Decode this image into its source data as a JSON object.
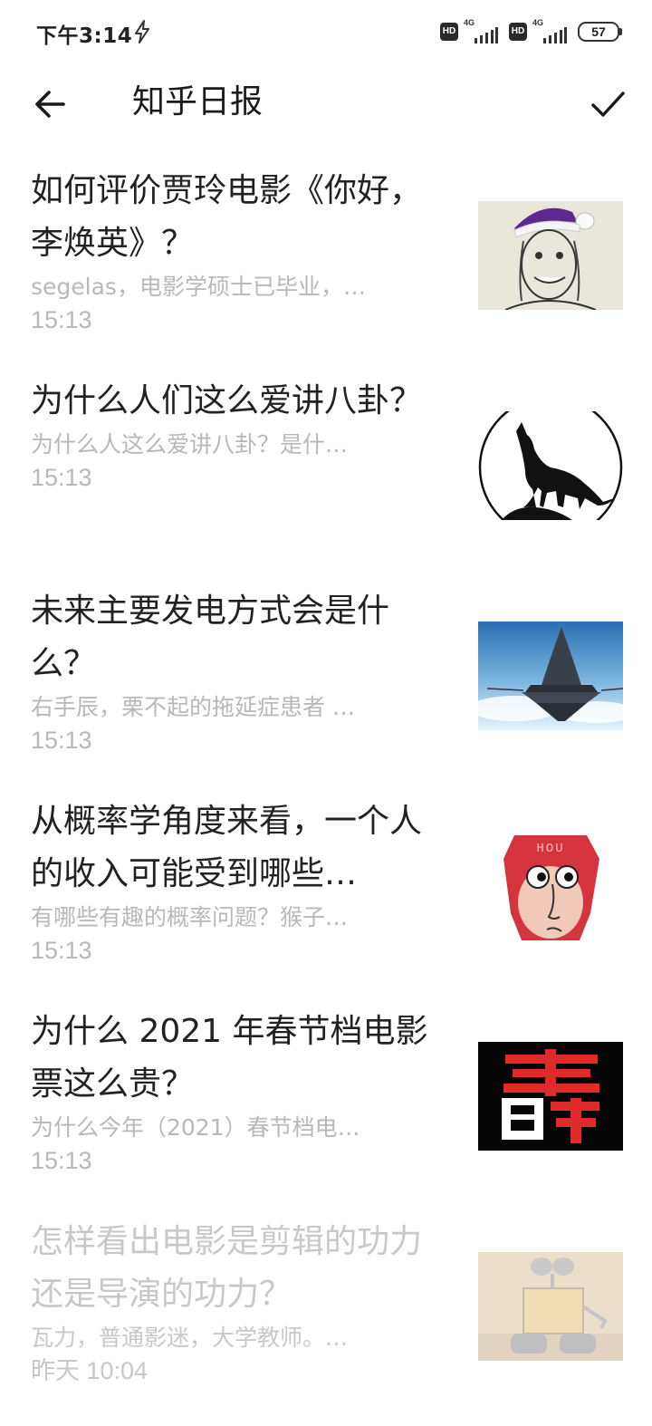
{
  "status_bar": {
    "time": "下午3:14",
    "hd_label": "HD",
    "network_label": "4G",
    "battery_level": "57"
  },
  "app_bar": {
    "title": "知乎日报"
  },
  "stories": [
    {
      "title": "如何评价贾玲电影《你好，李焕英》？",
      "hint": "segelas，电影学硕士已毕业，…",
      "date": "15:13",
      "thumb_icon": "caricature-santa-hat-image",
      "read": false
    },
    {
      "title": "为什么人们这么爱讲八卦？",
      "hint": "为什么人这么爱讲八卦？是什…",
      "date": "15:13",
      "thumb_icon": "howling-wolf-image",
      "read": false
    },
    {
      "title": "未来主要发电方式会是什么？",
      "hint": "右手辰，栗不起的拖延症患者 …",
      "date": "15:13",
      "thumb_icon": "floating-tower-sky-image",
      "read": false
    },
    {
      "title": "从概率学角度来看，一个人的收入可能受到哪些…",
      "hint": "有哪些有趣的概率问题？猴子…",
      "date": "15:13",
      "thumb_icon": "red-monkey-hou-image",
      "thumb_text": "HOU",
      "read": false
    },
    {
      "title": "为什么 2021 年春节档电影票这么贵？",
      "hint": "为什么今年（2021）春节档电…",
      "date": "15:13",
      "thumb_icon": "red-glyph-logo-image",
      "read": false
    },
    {
      "title": "怎样看出电影是剪辑的功力还是导演的功力？",
      "hint": "瓦力，普通影迷，大学教师。…",
      "date": "昨天 10:04",
      "thumb_icon": "robot-wall-e-image",
      "read": true
    }
  ],
  "colors": {
    "title_text": "#222222",
    "hint_text": "#b8b8b8",
    "read_text": "#c8c8c8",
    "background": "#ffffff"
  }
}
